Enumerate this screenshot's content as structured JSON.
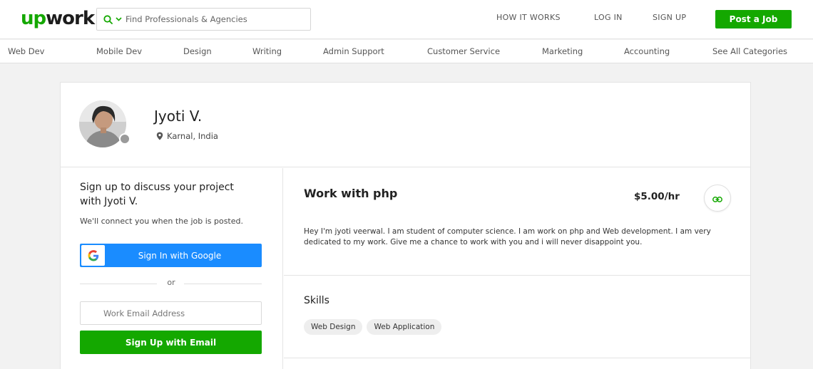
{
  "header": {
    "logo_up": "up",
    "logo_work": "work",
    "search_placeholder": "Find Professionals & Agencies",
    "nav": [
      "HOW IT WORKS",
      "LOG IN",
      "SIGN UP"
    ],
    "post_job": "Post a Job"
  },
  "categories": [
    "Web Dev",
    "Mobile Dev",
    "Design",
    "Writing",
    "Admin Support",
    "Customer Service",
    "Marketing",
    "Accounting",
    "See All Categories"
  ],
  "profile": {
    "name": "Jyoti V.",
    "location": "Karnal, India"
  },
  "signup": {
    "title": "Sign up to discuss your project with Jyoti V.",
    "subtitle": "We'll connect you when the job is posted.",
    "google_label": "Sign In with Google",
    "or": "or",
    "email_placeholder": "Work Email Address",
    "email_button": "Sign Up with Email"
  },
  "job": {
    "title": "Work with php",
    "rate": "$5.00/hr",
    "description": "Hey I'm jyoti veerwal. I am student of computer science. I am work on php and Web development. I am very dedicated to my work. Give me a chance to work with you and i will never disappoint you."
  },
  "skills": {
    "heading": "Skills",
    "items": [
      "Web Design",
      "Web Application"
    ]
  },
  "colors": {
    "brand_green": "#14a800",
    "google_blue": "#1a8cff"
  }
}
